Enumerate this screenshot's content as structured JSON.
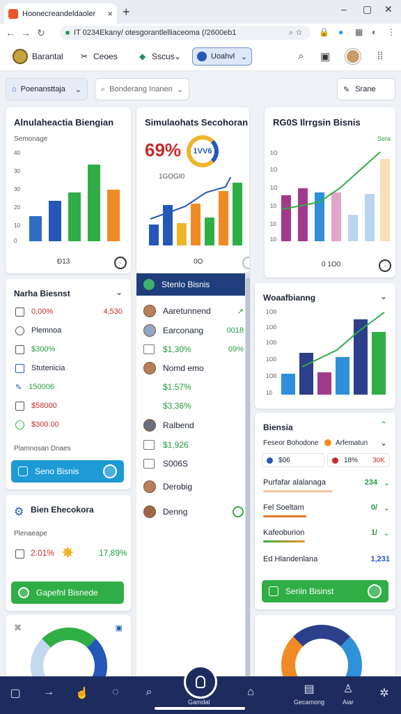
{
  "browser": {
    "tab_title": "Hoonecreandeldaoler",
    "close_glyph": "×",
    "newtab_glyph": "+",
    "url": "IT 0234Ekany/ otesgorantlelliaceoma (/2600eb1",
    "win_min": "–",
    "win_max": "▢",
    "win_close": "✕"
  },
  "app_header": {
    "brand": "Barantal",
    "item1": "Ceoes",
    "item2": "Sscus",
    "button": "Uoahvl"
  },
  "filters": {
    "primary": "Poenansttaja",
    "search_placeholder": "Bonderang Inanen",
    "right": "Srane"
  },
  "card1": {
    "title": "Alnulaheactia Biengian",
    "subtitle": "Semonage",
    "footer": "Ð13",
    "y_ticks": [
      "40",
      "30",
      "30",
      "20",
      "10",
      "0"
    ]
  },
  "card2": {
    "title": "Simulaohats Secohoran",
    "kpi": "69%",
    "kpi_badge": "1VV6",
    "kpi_sub": "1GOGI0",
    "footer": "0O"
  },
  "card3": {
    "title": "RG0S Ilrrgsin Bisnis",
    "corner": "Sera",
    "y_ticks": [
      "1O",
      "1O",
      "1O",
      "10",
      "10",
      "10"
    ],
    "footer": "0 1O0"
  },
  "card4": {
    "title": "Narha Biesnst",
    "rows": [
      {
        "label": "0,00%",
        "value": "4,530",
        "tone": "red"
      },
      {
        "label": "Plemnoa",
        "value": "",
        "tone": "plain"
      },
      {
        "label": "$300%",
        "value": "",
        "tone": "green"
      },
      {
        "label": "Stutenicia",
        "value": "",
        "tone": "plain"
      },
      {
        "label": "150006",
        "value": "",
        "tone": "green"
      },
      {
        "label": "$58000",
        "value": "",
        "tone": "red"
      },
      {
        "label": "$300.00",
        "value": "",
        "tone": "red"
      }
    ],
    "caption": "Plamnosan Dnaes",
    "button": "Seno Bisnis"
  },
  "card5": {
    "title": "Bien Ehecokora",
    "subtitle": "Plenaeape",
    "value_left": "2.01%",
    "value_right": "17,89%",
    "button": "Gapefnl Bisnede"
  },
  "middle": {
    "header": "Stenlo Bisnis",
    "rows": [
      {
        "label": "Aaretunnend",
        "value": "↗"
      },
      {
        "label": "Earconang",
        "value": "0018"
      },
      {
        "label": "$1,30%",
        "value": "09%"
      },
      {
        "label": "Nomd emo",
        "value": ""
      },
      {
        "label": "$1,57%",
        "value": ""
      },
      {
        "label": "$3,36%",
        "value": ""
      },
      {
        "label": "Ralbend",
        "value": ""
      },
      {
        "label": "$1,926",
        "value": ""
      },
      {
        "label": "S006S",
        "value": ""
      },
      {
        "label": "Derobig",
        "value": ""
      },
      {
        "label": "Denng",
        "value": ""
      }
    ]
  },
  "card6": {
    "title": "Woaafbianng",
    "y_ticks": [
      "1O0",
      "1O0",
      "1O0",
      "1O0",
      "1O0",
      "10"
    ]
  },
  "card7": {
    "title": "Biensia",
    "chip1": "Feseor Bohodone",
    "chip2": "Arfematun",
    "pill1": "$06",
    "pill2": "18%",
    "pill2_right": "30K",
    "progress": [
      {
        "label": "Purfafar alalanaga",
        "value": "234",
        "fill": 0.6,
        "color": "#f08a24"
      },
      {
        "label": "Fel Soeltam",
        "value": "0/",
        "fill": 0.45,
        "color": "#e0782a"
      },
      {
        "label": "Kafeoburion",
        "value": "1/",
        "fill": 0.4,
        "color": "#2fae46"
      },
      {
        "label": "Ed Hlandenlana",
        "value": "1,231",
        "fill": 0.0,
        "color": "#2fae46"
      }
    ],
    "button": "Seriin Bisinst"
  },
  "bottom": {
    "center_label": "Gamdal",
    "right_label": "Gecamong",
    "far_label": "Aiar"
  },
  "colors": {
    "blue": "#2f6ec2",
    "green": "#2fae46",
    "orange": "#f08a24",
    "purple": "#a23a8c",
    "navy": "#1f3d7a"
  }
}
